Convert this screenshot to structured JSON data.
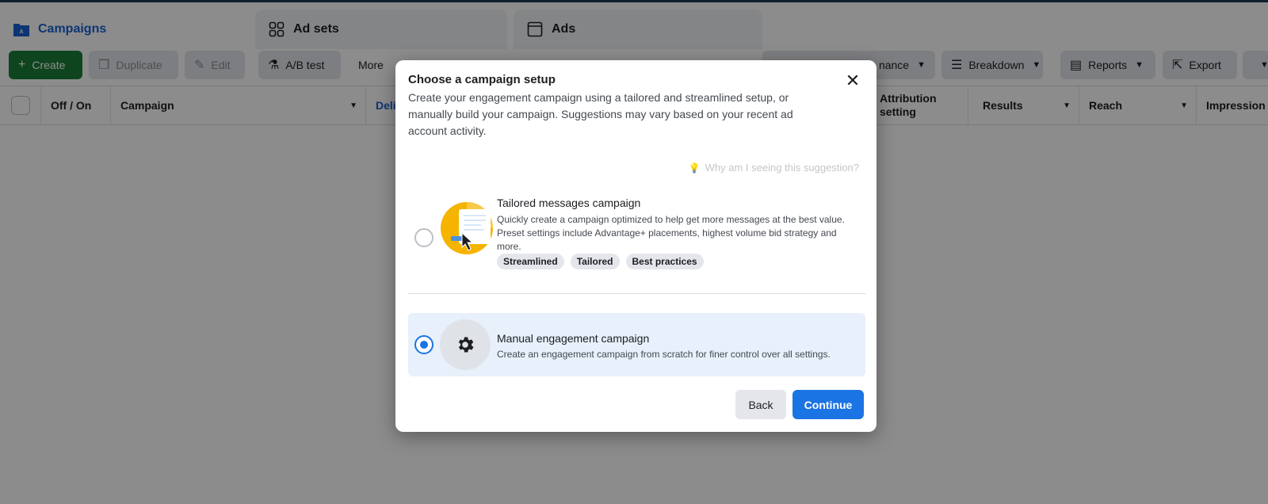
{
  "tabs": [
    {
      "label": "Campaigns",
      "icon": "folder-icon"
    },
    {
      "label": "Ad sets",
      "icon": "grid-icon"
    },
    {
      "label": "Ads",
      "icon": "ad-window-icon"
    }
  ],
  "toolbar": {
    "create": "Create",
    "duplicate": "Duplicate",
    "edit": "Edit",
    "ab_test": "A/B test",
    "more": "More",
    "performance": "nance",
    "breakdown": "Breakdown",
    "reports": "Reports",
    "export": "Export"
  },
  "table": {
    "columns": [
      "Off / On",
      "Campaign",
      "Deli",
      "Attribution setting",
      "Results",
      "Reach",
      "Impression"
    ]
  },
  "modal": {
    "title": "Choose a campaign setup",
    "description": "Create your engagement campaign using a tailored and streamlined setup, or manually build your campaign. Suggestions may vary based on your recent ad account activity.",
    "why_link": "Why am I seeing this suggestion?",
    "options": [
      {
        "title": "Tailored messages campaign",
        "description": "Quickly create a campaign optimized to help get more messages at the best value. Preset settings include Advantage+ placements, highest volume bid strategy and more.",
        "tags": [
          "Streamlined",
          "Tailored",
          "Best practices"
        ],
        "selected": false
      },
      {
        "title": "Manual engagement campaign",
        "description": "Create an engagement campaign from scratch for finer control over all settings.",
        "selected": true
      }
    ],
    "back": "Back",
    "continue": "Continue"
  },
  "colors": {
    "accent": "#1b74e4",
    "create_green": "#1a7f37",
    "selected_bg": "#e7f0fb"
  }
}
